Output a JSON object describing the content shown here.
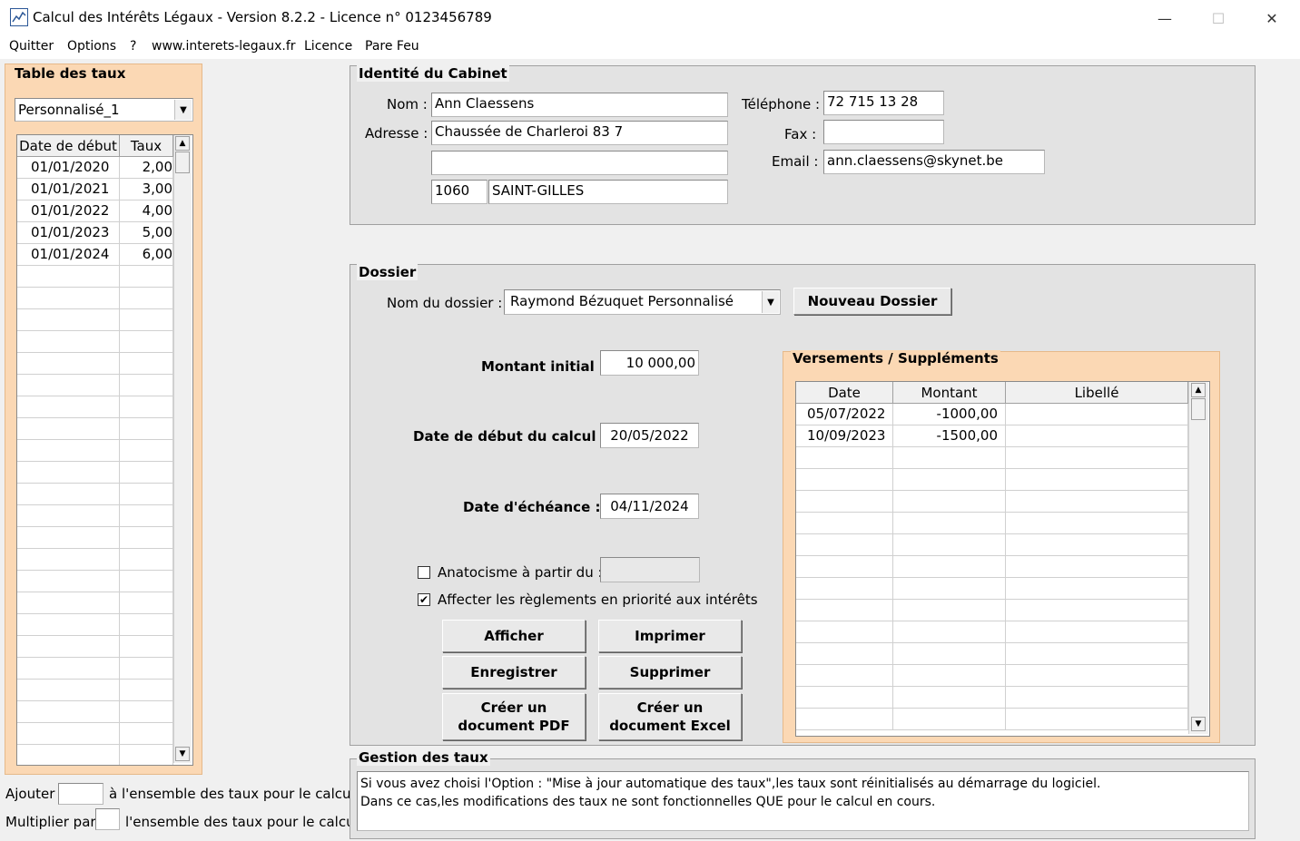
{
  "window": {
    "title": "Calcul des Intérêts Légaux - Version 8.2.2 - Licence n° 0123456789",
    "minimize": "—",
    "maximize": "☐",
    "close": "✕"
  },
  "menu": [
    "Quitter",
    "Options",
    "?",
    "www.interets-legaux.fr",
    "Licence",
    "Pare Feu"
  ],
  "table_taux": {
    "title": "Table des taux",
    "selected": "Personnalisé_1",
    "columns": [
      "Date de début",
      "Taux"
    ],
    "rows": [
      [
        "01/01/2020",
        "2,00"
      ],
      [
        "01/01/2021",
        "3,00"
      ],
      [
        "01/01/2022",
        "4,00"
      ],
      [
        "01/01/2023",
        "5,00"
      ],
      [
        "01/01/2024",
        "6,00"
      ]
    ]
  },
  "bottom_left": {
    "ajouter_label": "Ajouter",
    "ajouter_suffix": "à l'ensemble des taux pour le calcul",
    "multiplier_label": "Multiplier par",
    "multiplier_suffix": "l'ensemble des taux pour le calcul"
  },
  "cabinet": {
    "title": "Identité du Cabinet",
    "nom_label": "Nom :",
    "nom": "Ann Claessens",
    "adresse_label": "Adresse :",
    "adresse1": "Chaussée de Charleroi 83 7",
    "adresse2": "",
    "code_postal": "1060",
    "ville": "SAINT-GILLES",
    "telephone_label": "Téléphone :",
    "telephone": "72 715 13 28",
    "fax_label": "Fax :",
    "fax": "",
    "email_label": "Email :",
    "email": "ann.claessens@skynet.be"
  },
  "dossier": {
    "title": "Dossier",
    "nom_label": "Nom du dossier :",
    "nom": "Raymond Bézuquet Personnalisé",
    "nouveau_btn": "Nouveau Dossier",
    "montant_label": "Montant initial :",
    "montant": "10 000,00",
    "date_debut_label": "Date de début du calcul :",
    "date_debut": "20/05/2022",
    "date_echeance_label": "Date d'échéance :",
    "date_echeance": "04/11/2024",
    "anatocisme_label": "Anatocisme à partir du :",
    "anatocisme_checked": false,
    "anatocisme_value": "",
    "affecter_label": "Affecter les règlements en priorité aux intérêts",
    "affecter_checked": true,
    "buttons": {
      "afficher": "Afficher",
      "imprimer": "Imprimer",
      "enregistrer": "Enregistrer",
      "supprimer": "Supprimer",
      "pdf_line1": "Créer un",
      "pdf_line2": "document PDF",
      "excel_line1": "Créer un",
      "excel_line2": "document Excel"
    }
  },
  "versements": {
    "title": "Versements / Suppléments",
    "columns": [
      "Date",
      "Montant",
      "Libellé"
    ],
    "rows": [
      [
        "05/07/2022",
        "-1000,00",
        ""
      ],
      [
        "10/09/2023",
        "-1500,00",
        ""
      ]
    ]
  },
  "gestion": {
    "title": "Gestion des taux",
    "line1": "Si vous avez choisi l'Option : \"Mise à jour automatique des taux\",les taux sont réinitialisés au démarrage du logiciel.",
    "line2": "Dans ce cas,les modifications des taux ne sont fonctionnelles QUE pour le calcul en cours."
  },
  "colors": {
    "peach": "#fbd8b4",
    "window_bg": "#f0f0f0"
  },
  "icons": {
    "app": "chart-icon",
    "combo": "chevron-down-icon",
    "scroll_up": "arrow-up-icon",
    "scroll_down": "arrow-down-icon",
    "check": "check-icon"
  }
}
